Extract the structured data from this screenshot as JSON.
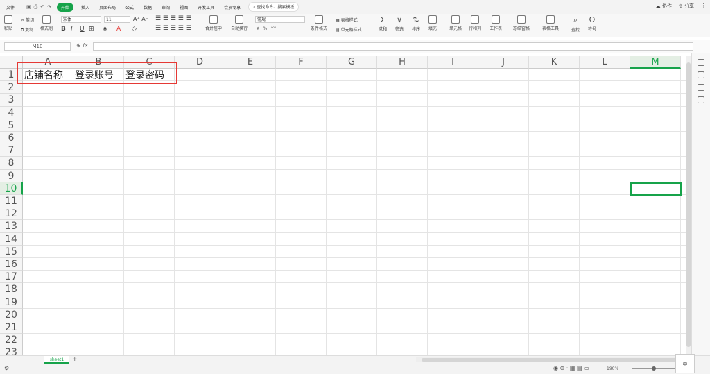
{
  "menu": {
    "file": "文件",
    "tabs": [
      "开始",
      "插入",
      "页面布局",
      "公式",
      "数据",
      "审阅",
      "视图",
      "开发工具",
      "会员专享"
    ],
    "active_tab": "开始",
    "search": "查找命令、搜索模板",
    "collab": "协作",
    "share": "分享"
  },
  "ribbon": {
    "paste": "粘贴",
    "cut": "剪切",
    "copy": "复制",
    "format_painter": "格式刷",
    "font_name": "宋体",
    "font_size": "11",
    "merge": "合并居中",
    "wrap": "自动换行",
    "number_format": "常规",
    "cond_format": "条件格式",
    "table_style": "表格样式",
    "cell_style": "单元格样式",
    "sum": "求和",
    "filter": "筛选",
    "sort": "排序",
    "fill": "填充",
    "cell": "单元格",
    "rows_cols": "行和列",
    "worksheet": "工作表",
    "freeze": "冻结窗格",
    "table_tools": "表格工具",
    "find": "查找",
    "symbol": "符号"
  },
  "namebox": "M10",
  "fx": "fx",
  "columns": [
    "A",
    "B",
    "C",
    "D",
    "E",
    "F",
    "G",
    "H",
    "I",
    "J",
    "K",
    "L",
    "M"
  ],
  "selected_column": "M",
  "rows": [
    "1",
    "2",
    "3",
    "4",
    "5",
    "6",
    "7",
    "8",
    "9",
    "10",
    "11",
    "12",
    "13",
    "14",
    "15",
    "16",
    "17",
    "18",
    "19",
    "20",
    "21",
    "22",
    "23"
  ],
  "selected_row": "10",
  "cells": {
    "A1": "店铺名称",
    "B1": "登录账号",
    "C1": "登录密码"
  },
  "sheet_tab": "sheet1",
  "add_sheet": "+",
  "zoom": "190%",
  "ime": "中"
}
